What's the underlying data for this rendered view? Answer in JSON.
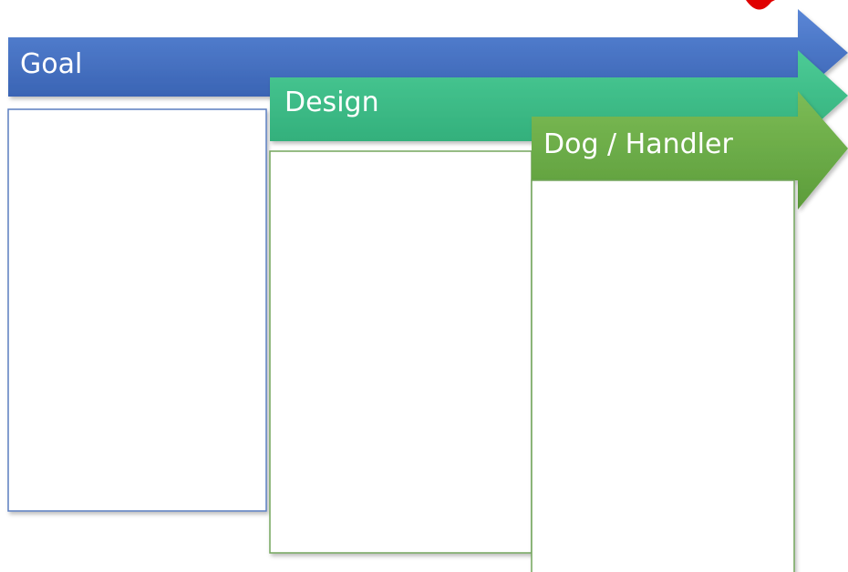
{
  "colors": {
    "goal": "#4472c4",
    "design": "#3cc088",
    "dog_handler": "#6aac46",
    "corner_mark": "#e00000",
    "panel_border_blue": "#5b7fc0",
    "panel_border_green": "#73a55c"
  },
  "stages": [
    {
      "id": "goal",
      "label": "Goal"
    },
    {
      "id": "design",
      "label": "Design"
    },
    {
      "id": "dog_handler",
      "label": "Dog / Handler"
    }
  ]
}
